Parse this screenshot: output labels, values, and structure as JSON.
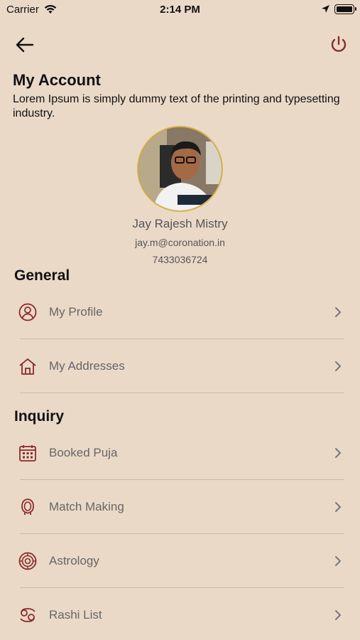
{
  "status_bar": {
    "carrier": "Carrier",
    "time": "2:14 PM"
  },
  "header": {
    "title": "My Account",
    "description": "Lorem Ipsum is simply dummy text of the printing and typesetting industry."
  },
  "profile": {
    "name": "Jay Rajesh Mistry",
    "email": "jay.m@coronation.in",
    "phone": "7433036724"
  },
  "sections": {
    "general": {
      "title": "General",
      "items": [
        {
          "label": "My Profile",
          "icon": "user-circle-icon"
        },
        {
          "label": "My Addresses",
          "icon": "home-icon"
        }
      ]
    },
    "inquiry": {
      "title": "Inquiry",
      "items": [
        {
          "label": "Booked Puja",
          "icon": "calendar-icon"
        },
        {
          "label": "Match Making",
          "icon": "match-making-icon"
        },
        {
          "label": "Astrology",
          "icon": "astrology-icon"
        },
        {
          "label": "Rashi List",
          "icon": "rashi-icon"
        }
      ]
    }
  },
  "colors": {
    "background": "#ebd9c8",
    "accent": "#8b2a2a",
    "avatar_border": "#d9b24a"
  }
}
